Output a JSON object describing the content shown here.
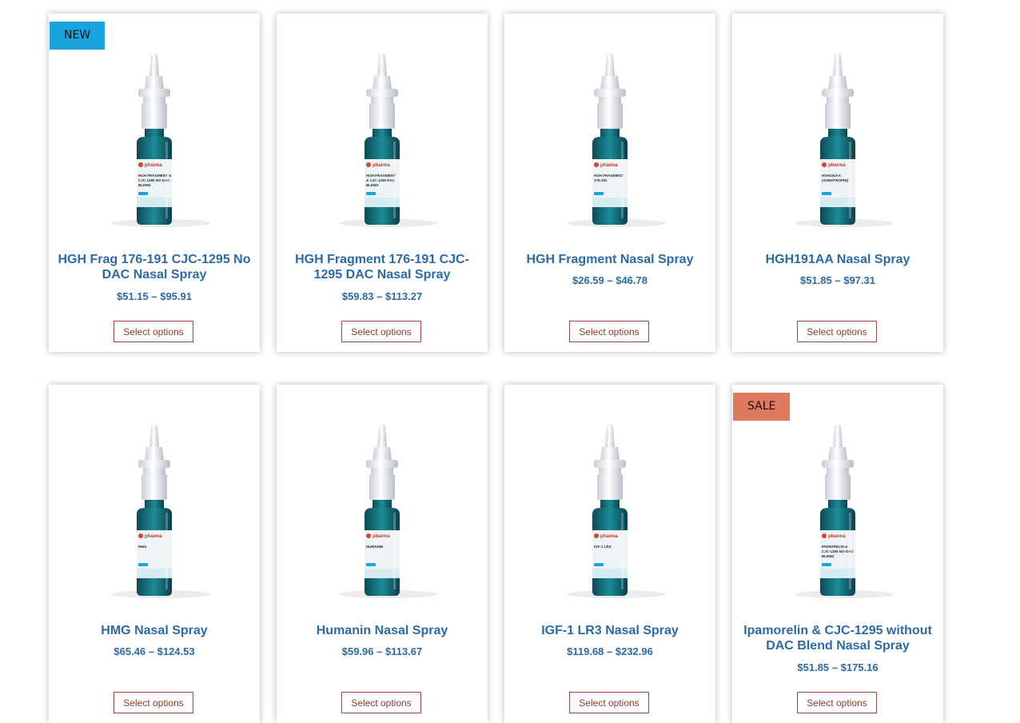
{
  "badges": {
    "new": "NEW",
    "sale": "SALE"
  },
  "colors": {
    "badge_new": "#1aa3dc",
    "badge_sale": "#e07a5f",
    "title": "#2c6aa6",
    "button_border": "#a24a3c"
  },
  "products": [
    {
      "title": "HGH Frag 176-191 CJC-1295 No DAC Nasal Spray",
      "price": "$51.15 – $95.91",
      "button": "Select options",
      "bottle_label": [
        "HGH FRAGMENT &",
        "CJC-1295 NO DAC",
        "BLEND"
      ],
      "brand": "pharma"
    },
    {
      "title": "HGH Fragment 176-191 CJC-1295 DAC Nasal Spray",
      "price": "$59.83 – $113.27",
      "button": "Select options",
      "bottle_label": [
        "HGH FRAGMENT",
        "& CJC-1295 DAC",
        "BLEND"
      ],
      "brand": "pharma"
    },
    {
      "title": "HGH Fragment Nasal Spray",
      "price": "$26.59 – $46.78",
      "button": "Select options",
      "bottle_label": [
        "HGH FRAGMENT",
        "176-191"
      ],
      "brand": "pharma"
    },
    {
      "title": "HGH191AA Nasal Spray",
      "price": "$51.85 – $97.31",
      "button": "Select options",
      "bottle_label": [
        "HGH191AA",
        "(SOMATROPIN)"
      ],
      "brand": "pharma"
    },
    {
      "title": "HMG Nasal Spray",
      "price": "$65.46 – $124.53",
      "button": "Select options",
      "bottle_label": [
        "HMG"
      ],
      "brand": "pharma"
    },
    {
      "title": "Humanin Nasal Spray",
      "price": "$59.96 – $113.67",
      "button": "Select options",
      "bottle_label": [
        "HUMANIN"
      ],
      "brand": "pharma"
    },
    {
      "title": "IGF-1 LR3 Nasal Spray",
      "price": "$119.68 – $232.96",
      "button": "Select options",
      "bottle_label": [
        "IGF-1 LR3"
      ],
      "brand": "pharma"
    },
    {
      "title": "Ipamorelin & CJC-1295 without DAC Blend Nasal Spray",
      "price": "$51.85 – $175.16",
      "button": "Select options",
      "bottle_label": [
        "IPAMORELIN &",
        "CJC-1295 NO-DAC",
        "BLEND"
      ],
      "brand": "pharma"
    }
  ]
}
